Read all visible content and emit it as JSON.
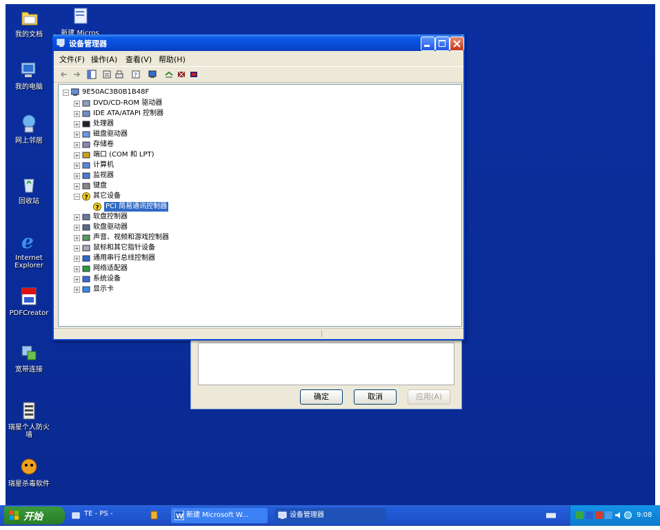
{
  "desktop": {
    "icons": [
      {
        "label": "我的文档",
        "icon": "folder-documents-icon"
      },
      {
        "label": "我的电脑",
        "icon": "my-computer-icon"
      },
      {
        "label": "网上邻居",
        "icon": "network-places-icon"
      },
      {
        "label": "回收站",
        "icon": "recycle-bin-icon"
      },
      {
        "label": "Internet Explorer",
        "icon": "ie-icon"
      },
      {
        "label": "PDFCreator",
        "icon": "pdf-icon"
      },
      {
        "label": "宽带连接",
        "icon": "broadband-icon"
      },
      {
        "label": "瑞星个人防火墙",
        "icon": "firewall-icon"
      },
      {
        "label": "瑞星杀毒软件",
        "icon": "antivirus-icon"
      }
    ],
    "partial_icon_label": "新建 Micros"
  },
  "dialog_back": {
    "buttons": {
      "ok": "确定",
      "cancel": "取消",
      "apply": "应用(A)"
    }
  },
  "window": {
    "title": "设备管理器",
    "menus": [
      "文件(F)",
      "操作(A)",
      "查看(V)",
      "帮助(H)"
    ],
    "tree": {
      "root": "9E50AC3B0B1B48F",
      "nodes": [
        {
          "label": "DVD/CD-ROM 驱动器",
          "icon": "cdrom-icon"
        },
        {
          "label": "IDE ATA/ATAPI 控制器",
          "icon": "ide-icon"
        },
        {
          "label": "处理器",
          "icon": "cpu-icon"
        },
        {
          "label": "磁盘驱动器",
          "icon": "disk-icon"
        },
        {
          "label": "存储卷",
          "icon": "volume-icon"
        },
        {
          "label": "端口 (COM 和 LPT)",
          "icon": "port-icon"
        },
        {
          "label": "计算机",
          "icon": "computer-icon"
        },
        {
          "label": "监视器",
          "icon": "monitor-icon"
        },
        {
          "label": "键盘",
          "icon": "keyboard-icon"
        },
        {
          "label": "其它设备",
          "icon": "unknown-device-icon",
          "expanded": true
        },
        {
          "label": "PCI 简易通讯控制器",
          "icon": "warning-device-icon",
          "child": true,
          "selected": true
        },
        {
          "label": "软盘控制器",
          "icon": "floppy-controller-icon"
        },
        {
          "label": "软盘驱动器",
          "icon": "floppy-icon"
        },
        {
          "label": "声音、视频和游戏控制器",
          "icon": "sound-icon"
        },
        {
          "label": "鼠标和其它指针设备",
          "icon": "mouse-icon"
        },
        {
          "label": "通用串行总线控制器",
          "icon": "usb-icon"
        },
        {
          "label": "网络适配器",
          "icon": "network-adapter-icon"
        },
        {
          "label": "系统设备",
          "icon": "system-icon"
        },
        {
          "label": "显示卡",
          "icon": "display-adapter-icon"
        }
      ]
    }
  },
  "taskbar": {
    "start_label": "开始",
    "quick_launch": "TE - PS -",
    "tasks": [
      {
        "label": "新建 Microsoft W...",
        "icon": "word-icon",
        "active": false
      },
      {
        "label": "设备管理器",
        "icon": "device-manager-icon",
        "active": true
      }
    ],
    "clock": "9:08"
  },
  "colors": {
    "desktop": "#0a2c9c",
    "titlebar": "#0a5ae8",
    "selection": "#316ac5",
    "start_green": "#2f8b2f"
  }
}
